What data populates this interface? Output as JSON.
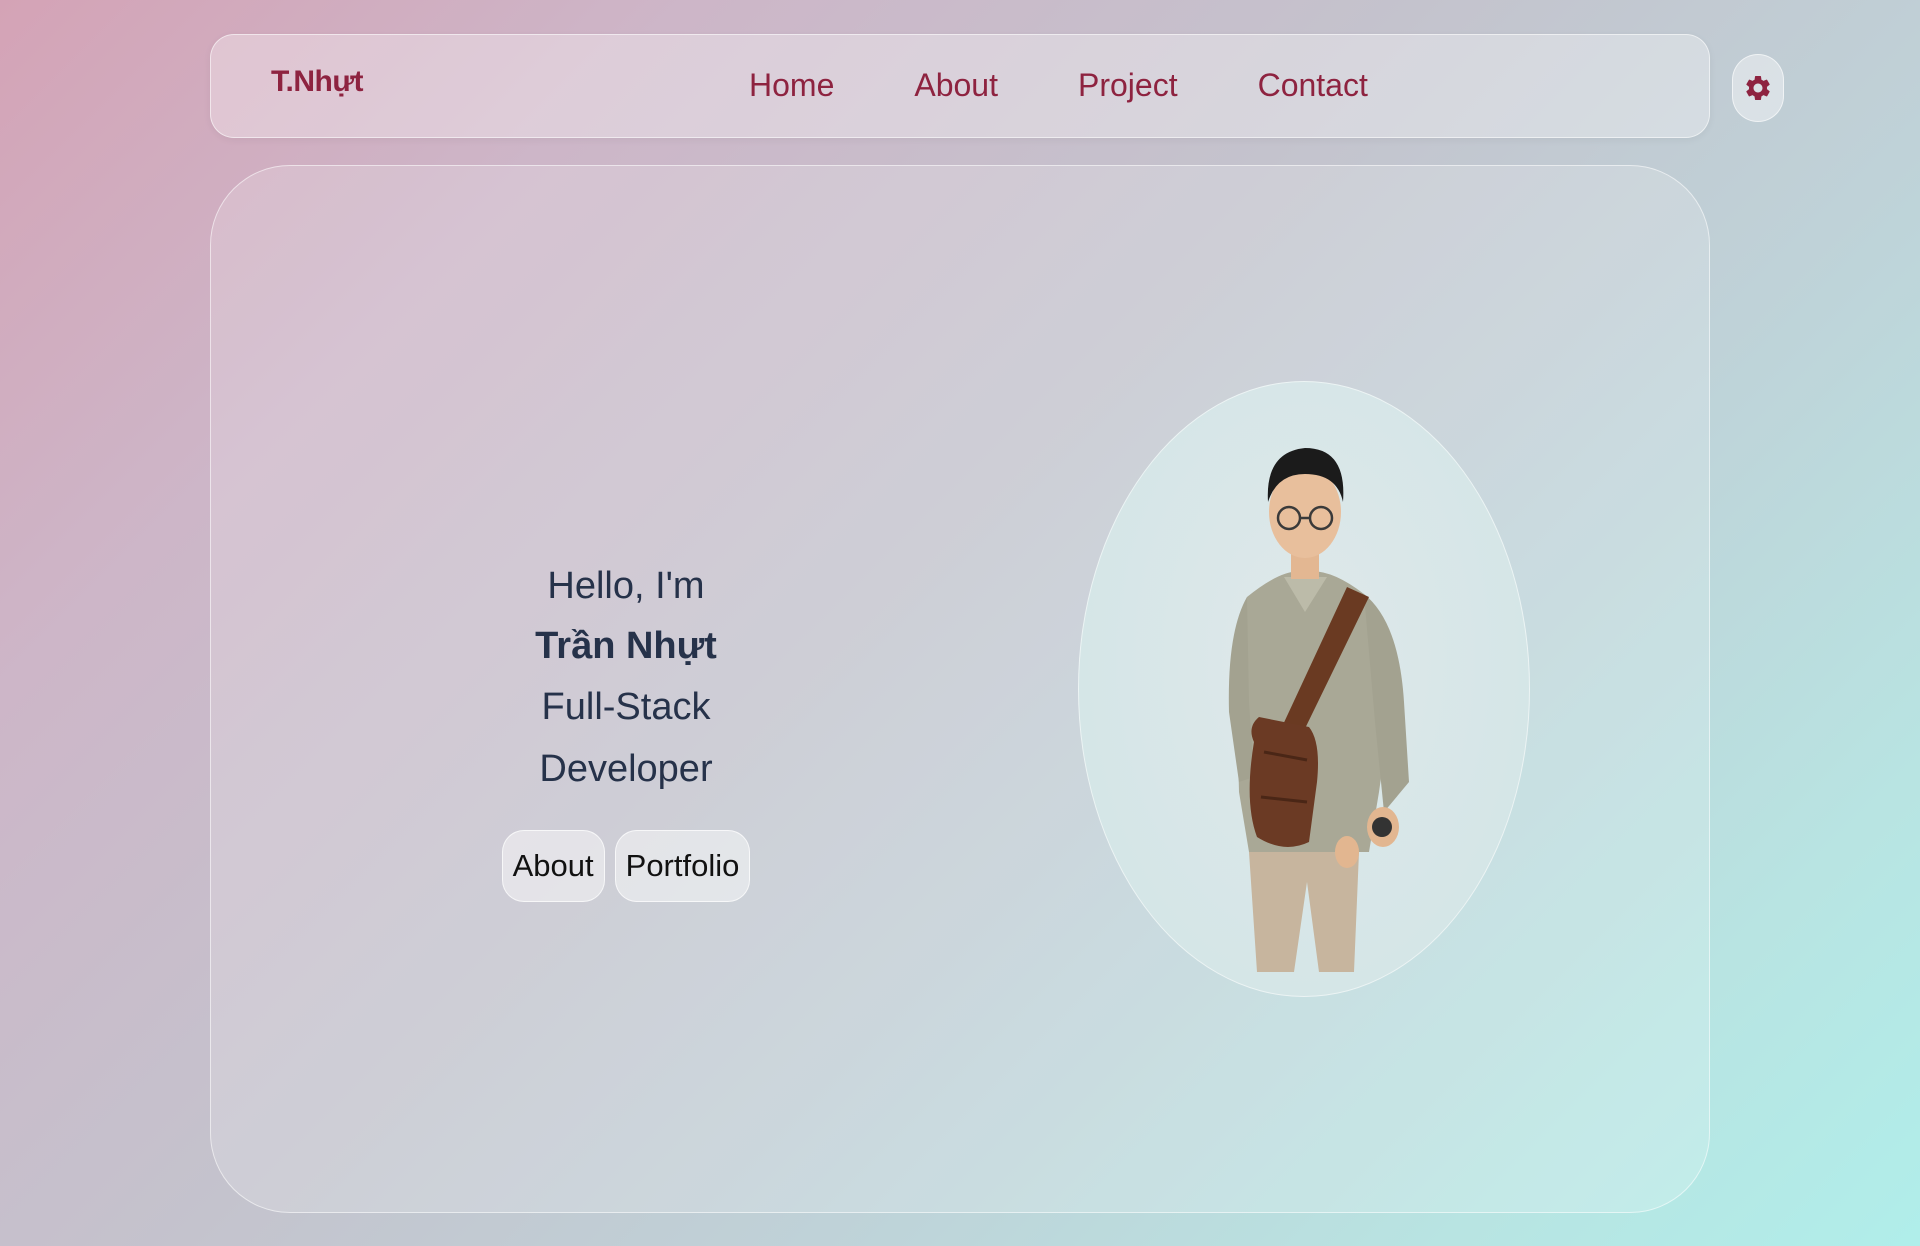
{
  "nav": {
    "brand": "T.Nhựt",
    "links": [
      "Home",
      "About",
      "Project",
      "Contact"
    ],
    "settings_icon": "gear-icon"
  },
  "hero": {
    "greeting": "Hello, I'm",
    "name": "Trần Nhựt",
    "role": "Full-Stack Developer",
    "buttons": [
      "About",
      "Portfolio"
    ],
    "portrait": "portrait-photo"
  },
  "colors": {
    "accent": "#8e2340",
    "text": "#26324a"
  }
}
